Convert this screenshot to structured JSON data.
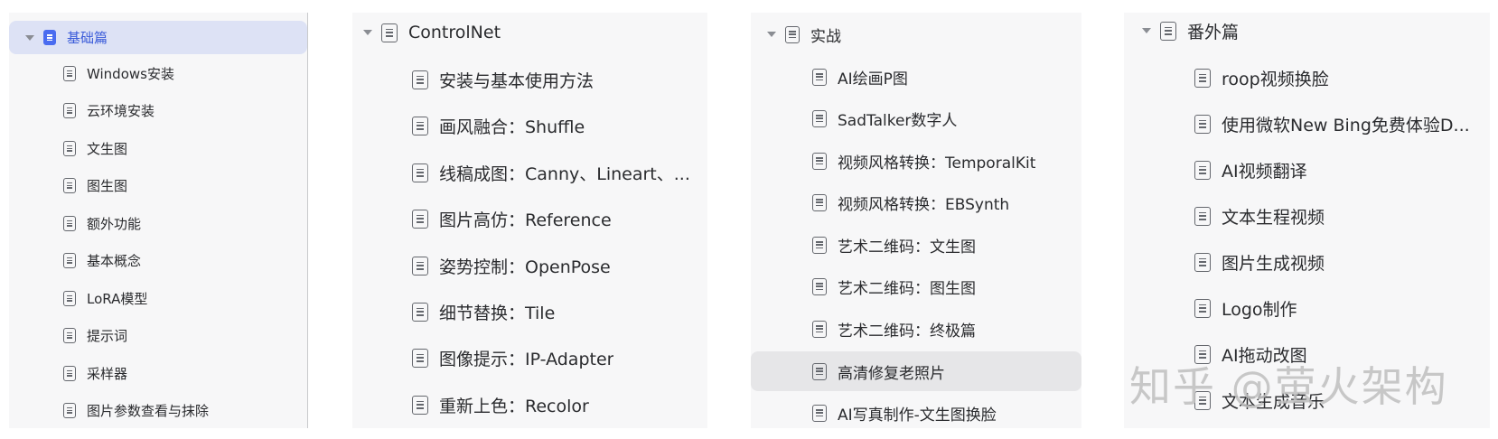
{
  "panels": [
    {
      "title": "基础篇",
      "items": [
        "Windows安装",
        "云环境安装",
        "文生图",
        "图生图",
        "额外功能",
        "基本概念",
        "LoRA模型",
        "提示词",
        "采样器",
        "图片参数查看与抹除"
      ]
    },
    {
      "title": "ControlNet",
      "items": [
        "安装与基本使用方法",
        "画风融合：Shuffle",
        "线稿成图：Canny、Lineart、...",
        "图片高仿：Reference",
        "姿势控制：OpenPose",
        "细节替换：Tile",
        "图像提示：IP-Adapter",
        "重新上色：Recolor"
      ]
    },
    {
      "title": "实战",
      "items": [
        "AI绘画P图",
        "SadTalker数字人",
        "视频风格转换：TemporalKit",
        "视频风格转换：EBSynth",
        "艺术二维码：文生图",
        "艺术二维码：图生图",
        "艺术二维码：终极篇",
        "高清修复老照片",
        "AI写真制作-文生图换脸"
      ]
    },
    {
      "title": "番外篇",
      "items": [
        "roop视频换脸",
        "使用微软New Bing免费体验D...",
        "AI视频翻译",
        "文本生程视频",
        "图片生成视频",
        "Logo制作",
        "AI拖动改图",
        "文本生成音乐"
      ]
    }
  ],
  "watermark": "知乎 @萤火架构",
  "colors": {
    "panel_bg": "#f7f7f8",
    "selected_bg": "#dde2f5",
    "selected_text": "#3a5bd9",
    "hover_bg": "#e6e6e8",
    "divider": "#c9cacc"
  },
  "icons": {
    "expand": "caret-down-icon",
    "doc": "document-icon"
  }
}
